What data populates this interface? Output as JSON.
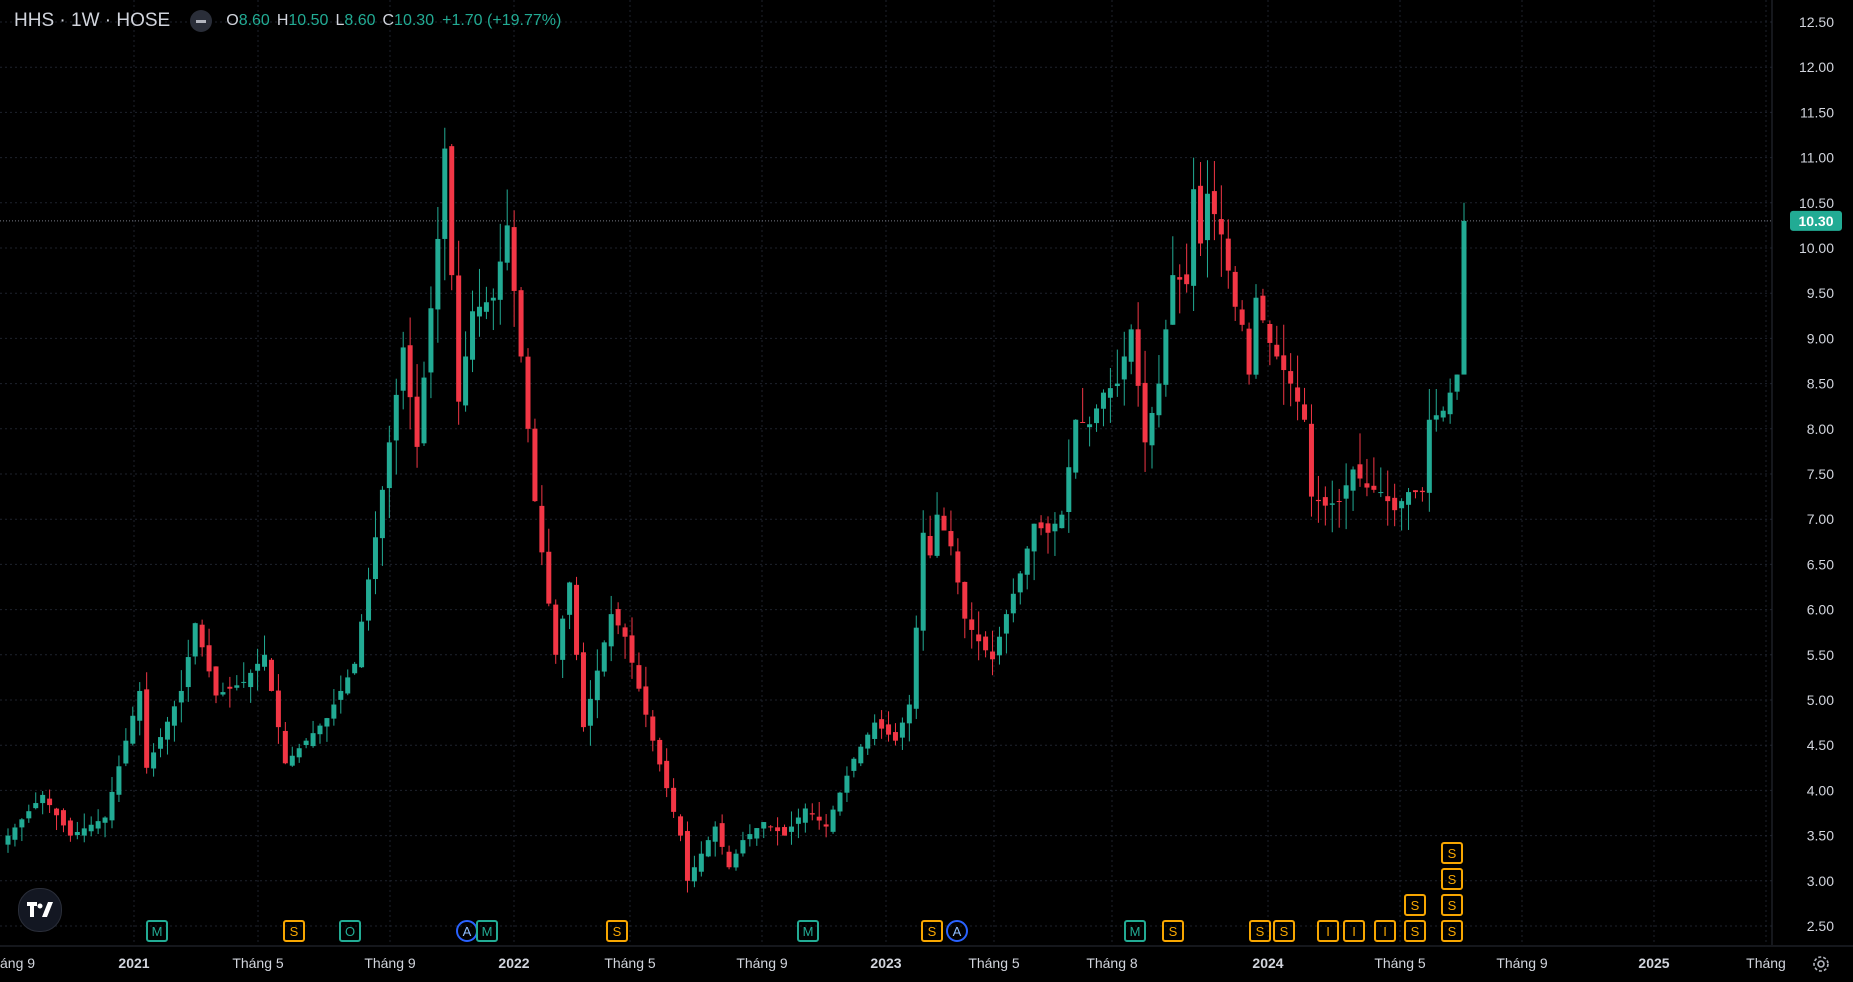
{
  "header": {
    "symbol": "HHS · 1W · HOSE",
    "open_label": "O",
    "open": "8.60",
    "high_label": "H",
    "high": "10.50",
    "low_label": "L",
    "low": "8.60",
    "close_label": "C",
    "close": "10.30",
    "change": "+1.70 (+19.77%)"
  },
  "colors": {
    "up": "#22ab94",
    "down": "#f23645",
    "background": "#000000",
    "grid": "#1e222d",
    "event_orange": "#f7a600",
    "event_green": "#22ab94",
    "event_blue": "#2962ff"
  },
  "icons": {
    "logo": "tradingview-logo-icon",
    "settings": "gear-icon",
    "legend_toggle": "minus-icon"
  },
  "chart_data": {
    "type": "candlestick",
    "interval": "1W",
    "y_axis": {
      "min": 2.5,
      "max": 12.5,
      "step": 0.5,
      "position": "right",
      "tick_labels": [
        "2.50",
        "3.00",
        "3.50",
        "4.00",
        "4.50",
        "5.00",
        "5.50",
        "6.00",
        "6.50",
        "7.00",
        "7.50",
        "8.00",
        "8.50",
        "9.00",
        "9.50",
        "10.00",
        "10.50",
        "11.00",
        "11.50",
        "12.00",
        "12.50"
      ]
    },
    "x_axis": {
      "tick_labels": [
        "áng 9",
        "2021",
        "Tháng 5",
        "Tháng 9",
        "2022",
        "Tháng 5",
        "Tháng 9",
        "2023",
        "Tháng 5",
        "Tháng 8",
        "2024",
        "Tháng 5",
        "Tháng 9",
        "2025",
        "Tháng"
      ]
    },
    "last_price": "10.30",
    "grid": true,
    "anchors": [
      [
        0,
        3.5
      ],
      [
        5,
        3.95
      ],
      [
        9,
        3.5
      ],
      [
        14,
        3.7
      ],
      [
        17,
        4.55
      ],
      [
        19,
        5.1
      ],
      [
        20,
        4.25
      ],
      [
        25,
        5.1
      ],
      [
        27,
        5.85
      ],
      [
        30,
        5.05
      ],
      [
        34,
        5.2
      ],
      [
        37,
        5.5
      ],
      [
        40,
        4.3
      ],
      [
        46,
        4.8
      ],
      [
        50,
        5.4
      ],
      [
        53,
        6.8
      ],
      [
        57,
        8.9
      ],
      [
        59,
        7.8
      ],
      [
        62,
        10.1
      ],
      [
        63,
        11.1
      ],
      [
        65,
        8.3
      ],
      [
        67,
        9.3
      ],
      [
        70,
        9.45
      ],
      [
        72,
        10.25
      ],
      [
        74,
        8.8
      ],
      [
        76,
        7.2
      ],
      [
        79,
        5.5
      ],
      [
        81,
        6.3
      ],
      [
        83,
        4.7
      ],
      [
        87,
        5.95
      ],
      [
        89,
        5.7
      ],
      [
        93,
        4.55
      ],
      [
        97,
        3.5
      ],
      [
        98,
        3.0
      ],
      [
        100,
        3.3
      ],
      [
        102,
        3.6
      ],
      [
        104,
        3.15
      ],
      [
        106,
        3.45
      ],
      [
        109,
        3.65
      ],
      [
        112,
        3.5
      ],
      [
        115,
        3.8
      ],
      [
        118,
        3.6
      ],
      [
        122,
        4.35
      ],
      [
        125,
        4.75
      ],
      [
        128,
        4.55
      ],
      [
        130,
        4.95
      ],
      [
        131,
        5.8
      ],
      [
        132,
        6.85
      ],
      [
        133,
        6.6
      ],
      [
        134,
        7.05
      ],
      [
        136,
        6.7
      ],
      [
        138,
        5.9
      ],
      [
        140,
        5.65
      ],
      [
        142,
        5.45
      ],
      [
        144,
        5.95
      ],
      [
        146,
        6.4
      ],
      [
        148,
        6.95
      ],
      [
        150,
        6.85
      ],
      [
        152,
        7.05
      ],
      [
        154,
        8.1
      ],
      [
        156,
        8.05
      ],
      [
        158,
        8.4
      ],
      [
        160,
        8.5
      ],
      [
        162,
        9.1
      ],
      [
        164,
        7.85
      ],
      [
        166,
        8.5
      ],
      [
        168,
        9.7
      ],
      [
        170,
        9.6
      ],
      [
        171,
        10.65
      ],
      [
        172,
        10.05
      ],
      [
        173,
        10.6
      ],
      [
        175,
        10.15
      ],
      [
        177,
        9.35
      ],
      [
        178,
        9.15
      ],
      [
        179,
        8.6
      ],
      [
        180,
        9.45
      ],
      [
        182,
        8.95
      ],
      [
        185,
        8.5
      ],
      [
        187,
        8.1
      ],
      [
        188,
        7.25
      ],
      [
        190,
        7.15
      ],
      [
        192,
        7.2
      ],
      [
        194,
        7.55
      ],
      [
        196,
        7.35
      ],
      [
        198,
        7.3
      ],
      [
        200,
        7.1
      ],
      [
        202,
        7.3
      ],
      [
        204,
        7.3
      ],
      [
        205,
        8.1
      ],
      [
        207,
        8.2
      ],
      [
        209,
        8.6
      ],
      [
        210,
        10.3
      ]
    ],
    "events": [
      {
        "label": "M",
        "color": "green",
        "x": "2021",
        "row": 0
      },
      {
        "label": "S",
        "color": "orange",
        "x": "Tháng 9",
        "row": 0
      },
      {
        "label": "O",
        "color": "green",
        "x": "Tháng 9",
        "row": 0
      },
      {
        "label": "A",
        "color": "blue",
        "x": "2022",
        "row": 0
      },
      {
        "label": "M",
        "color": "green",
        "x": "2022",
        "row": 0
      },
      {
        "label": "S",
        "color": "orange",
        "x": "Tháng 5",
        "row": 0
      },
      {
        "label": "M",
        "color": "green",
        "x": "2023",
        "row": 0
      },
      {
        "label": "S",
        "color": "orange",
        "x": "Tháng 8",
        "row": 0
      },
      {
        "label": "A",
        "color": "blue",
        "x": "Tháng 8",
        "row": 0
      },
      {
        "label": "M",
        "color": "green",
        "x": "2024",
        "row": 0
      },
      {
        "label": "S",
        "color": "orange",
        "x": "Tháng 5",
        "row": 0
      },
      {
        "label": "S",
        "color": "orange",
        "x": "Tháng 9",
        "row": 0
      },
      {
        "label": "S",
        "color": "orange",
        "x": "Tháng 9",
        "row": 0
      },
      {
        "label": "I",
        "color": "orange",
        "x": "2025",
        "row": 0
      },
      {
        "label": "I",
        "color": "orange",
        "x": "2025",
        "row": 0
      },
      {
        "label": "I",
        "color": "orange",
        "x": "2025",
        "row": 0
      },
      {
        "label": "S",
        "color": "orange",
        "x": "2025",
        "row": 0
      },
      {
        "label": "S",
        "color": "orange",
        "x": "2025",
        "row": 1
      },
      {
        "label": "S",
        "color": "orange",
        "x": "2025",
        "row": 0
      },
      {
        "label": "S",
        "color": "orange",
        "x": "2025",
        "row": 1
      },
      {
        "label": "S",
        "color": "orange",
        "x": "2025",
        "row": 2
      },
      {
        "label": "S",
        "color": "orange",
        "x": "2025",
        "row": 3
      }
    ]
  }
}
